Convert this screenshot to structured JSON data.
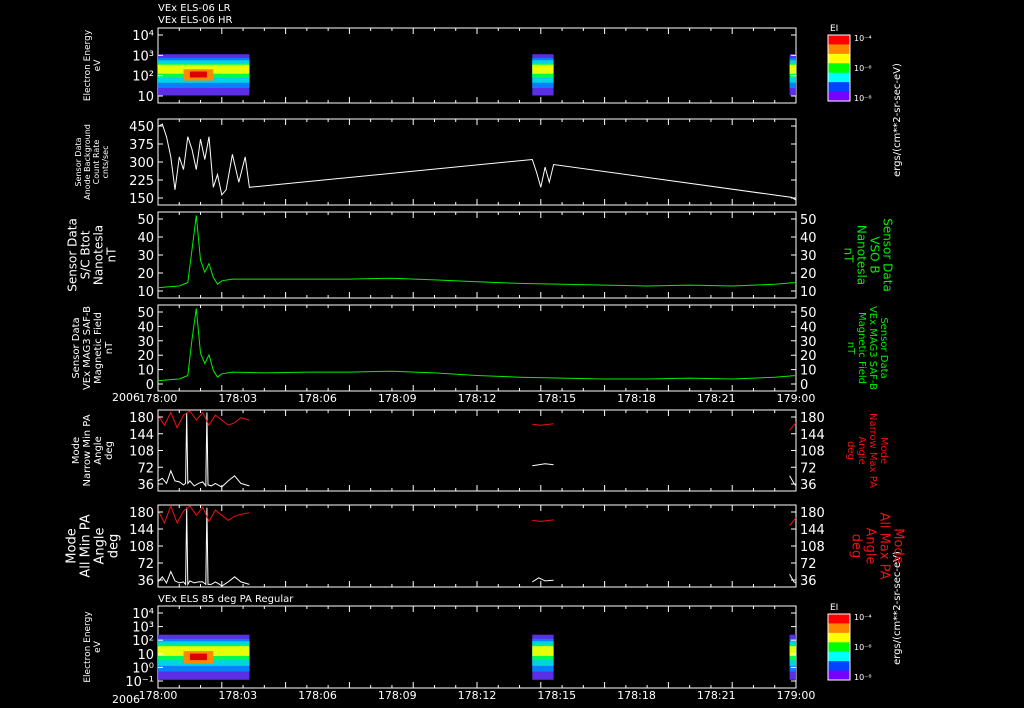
{
  "header": {
    "line1": "VEx ELS-06 LR",
    "line2": "VEx ELS-06 HR",
    "panel7_title": "VEx ELS 85 deg PA Regular"
  },
  "colorbar": {
    "label": "EI",
    "units": "ergs/(cm**2-sr-sec-eV)",
    "ticks": [
      "10⁻⁴",
      "10⁻⁶",
      "10⁻⁸"
    ]
  },
  "time_axis": {
    "year": "2006",
    "ticks": [
      "178:00",
      "178:03",
      "178:06",
      "178:09",
      "178:12",
      "178:15",
      "178:18",
      "178:21",
      "179:00"
    ]
  },
  "colors": {
    "green": "#00ee00",
    "red": "#ee1111",
    "white": "#ffffff"
  },
  "chart_data": [
    {
      "type": "heatmap",
      "panel": "electron-spectrogram-top",
      "ylabel": [
        "Electron Energy",
        "eV"
      ],
      "yticks": [
        "10⁴",
        "10³",
        "10²",
        "10"
      ],
      "ylog": true,
      "data_intervals_minutes": [
        [
          0.0,
          4.3
        ],
        [
          17.6,
          18.6
        ],
        [
          29.7,
          30.0
        ]
      ]
    },
    {
      "type": "line",
      "panel": "anode-count-rate",
      "ylabel": [
        "Sensor Data",
        "Anode Background",
        "Count Rate",
        "cnts/sec"
      ],
      "yticks": [
        "450",
        "375",
        "300",
        "225",
        "150"
      ],
      "ylim": [
        110,
        450
      ],
      "series": [
        {
          "color": "white",
          "x": [
            0.0,
            0.2,
            0.4,
            0.6,
            0.8,
            1.0,
            1.2,
            1.4,
            1.6,
            1.8,
            2.0,
            2.2,
            2.4,
            2.6,
            2.8,
            3.0,
            3.2,
            3.5,
            3.8,
            4.1,
            4.3,
            17.6,
            17.8,
            18.0,
            18.2,
            18.4,
            18.6,
            29.8,
            30.0
          ],
          "y": [
            420,
            430,
            380,
            300,
            170,
            300,
            250,
            380,
            330,
            250,
            370,
            290,
            380,
            180,
            230,
            150,
            170,
            310,
            200,
            300,
            180,
            290,
            240,
            180,
            260,
            200,
            270,
            140,
            130
          ]
        }
      ]
    },
    {
      "type": "line",
      "panel": "sc-bmag",
      "ylabel": [
        "Sensor Data",
        "S/C Btot",
        "Nanotesla",
        "nT"
      ],
      "ylabel_right": [
        "Sensor Data",
        "VSO B",
        "Nanotesla",
        "nT"
      ],
      "yticks": [
        "50",
        "40",
        "30",
        "20",
        "10"
      ],
      "ylim": [
        0,
        50
      ],
      "series": [
        {
          "color": "green",
          "x": [
            0,
            0.5,
            1.0,
            1.4,
            1.6,
            1.8,
            2.0,
            2.2,
            2.4,
            2.6,
            2.8,
            3.0,
            3.5,
            5,
            7,
            9,
            11,
            13,
            15,
            17,
            19,
            21,
            23,
            25,
            27,
            29,
            30
          ],
          "y": [
            6,
            6.5,
            7,
            9,
            28,
            48,
            22,
            15,
            20,
            12,
            8,
            10,
            11,
            11,
            11,
            11,
            11.5,
            10.5,
            9.5,
            8.5,
            8,
            7.5,
            7,
            7.5,
            7,
            8,
            9
          ]
        }
      ]
    },
    {
      "type": "line",
      "panel": "mag-field",
      "ylabel": [
        "Sensor Data",
        "VEx MAG3 SAF-B",
        "Magnetic Field",
        "nT"
      ],
      "ylabel_right": [
        "Sensor Data",
        "VEx MAG3 SAF-B",
        "Magnetic Field",
        "nT"
      ],
      "yticks": [
        "50",
        "40",
        "30",
        "20",
        "10",
        "0"
      ],
      "ylim": [
        0,
        50
      ],
      "series": [
        {
          "color": "green",
          "x": [
            0,
            0.5,
            1.0,
            1.4,
            1.6,
            1.8,
            2.0,
            2.2,
            2.4,
            2.6,
            2.8,
            3.0,
            3.5,
            5,
            7,
            9,
            11,
            13,
            15,
            17,
            19,
            21,
            23,
            25,
            27,
            29,
            30
          ],
          "y": [
            6,
            6.5,
            7,
            9,
            30,
            48,
            22,
            16,
            21,
            12,
            8,
            10,
            11,
            10.5,
            11,
            11,
            11.5,
            10.5,
            9,
            8,
            7.5,
            7,
            7,
            7.5,
            7,
            8,
            9
          ]
        }
      ]
    },
    {
      "type": "line",
      "panel": "narrow-pa",
      "ylabel": [
        "Mode",
        "Narrow Min PA",
        "Angle",
        "deg"
      ],
      "ylabel_right": [
        "Mode",
        "Narrow Max PA",
        "Angle",
        "deg"
      ],
      "yticks": [
        "180",
        "144",
        "108",
        "72",
        "36"
      ],
      "ylim": [
        20,
        180
      ],
      "series": [
        {
          "color": "white",
          "x": [
            0.0,
            0.2,
            0.4,
            0.6,
            0.8,
            1.0,
            1.2,
            1.3,
            1.35,
            1.4,
            1.5,
            1.7,
            1.9,
            2.1,
            2.25,
            2.3,
            2.35,
            2.5,
            2.7,
            2.9,
            3.0,
            3.3,
            3.6,
            3.9,
            4.3
          ],
          "y": [
            40,
            45,
            35,
            60,
            40,
            38,
            32,
            35,
            175,
            35,
            40,
            30,
            35,
            38,
            30,
            175,
            32,
            30,
            35,
            30,
            28,
            40,
            50,
            35,
            30
          ]
        },
        {
          "color": "white",
          "x": [
            17.6,
            17.9,
            18.2,
            18.6
          ],
          "y": [
            70,
            72,
            74,
            72
          ]
        },
        {
          "color": "white",
          "x": [
            29.7,
            29.9,
            30.0
          ],
          "y": [
            50,
            35,
            30
          ]
        },
        {
          "color": "red",
          "x": [
            0.0,
            0.3,
            0.6,
            0.9,
            1.2,
            1.5,
            1.8,
            2.1,
            2.4,
            2.7,
            3.0,
            3.3,
            3.6,
            3.9,
            4.3
          ],
          "y": [
            170,
            150,
            175,
            145,
            170,
            178,
            160,
            175,
            150,
            170,
            160,
            150,
            155,
            165,
            160
          ]
        },
        {
          "color": "red",
          "x": [
            17.6,
            18.0,
            18.6
          ],
          "y": [
            152,
            150,
            153
          ]
        },
        {
          "color": "red",
          "x": [
            29.7,
            30.0
          ],
          "y": [
            140,
            155
          ]
        }
      ]
    },
    {
      "type": "line",
      "panel": "all-pa",
      "ylabel": [
        "Mode",
        "All Min PA",
        "Angle",
        "deg"
      ],
      "ylabel_right": [
        "Mode",
        "All Max PA",
        "Angle",
        "deg"
      ],
      "yticks": [
        "180",
        "144",
        "108",
        "72",
        "36"
      ],
      "ylim": [
        20,
        180
      ],
      "series": [
        {
          "color": "white",
          "x": [
            0.0,
            0.2,
            0.4,
            0.6,
            0.8,
            1.0,
            1.2,
            1.3,
            1.35,
            1.4,
            1.5,
            1.7,
            1.9,
            2.1,
            2.25,
            2.3,
            2.35,
            2.5,
            2.7,
            2.9,
            3.0,
            3.3,
            3.6,
            3.9,
            4.3
          ],
          "y": [
            30,
            40,
            28,
            50,
            32,
            28,
            30,
            25,
            175,
            25,
            32,
            28,
            30,
            30,
            25,
            175,
            25,
            25,
            30,
            25,
            22,
            30,
            40,
            30,
            25
          ]
        },
        {
          "color": "white",
          "x": [
            17.6,
            17.9,
            18.2,
            18.6
          ],
          "y": [
            30,
            38,
            32,
            33
          ]
        },
        {
          "color": "white",
          "x": [
            29.7,
            29.9,
            30.0
          ],
          "y": [
            45,
            30,
            28
          ]
        },
        {
          "color": "red",
          "x": [
            0.0,
            0.3,
            0.6,
            0.9,
            1.2,
            1.5,
            1.8,
            2.1,
            2.4,
            2.7,
            3.0,
            3.3,
            3.6,
            3.9,
            4.3
          ],
          "y": [
            170,
            145,
            178,
            145,
            168,
            178,
            160,
            176,
            148,
            170,
            160,
            150,
            158,
            162,
            165
          ]
        },
        {
          "color": "red",
          "x": [
            17.6,
            18.0,
            18.6
          ],
          "y": [
            150,
            148,
            151
          ]
        },
        {
          "color": "red",
          "x": [
            29.7,
            30.0
          ],
          "y": [
            140,
            155
          ]
        }
      ]
    },
    {
      "type": "heatmap",
      "panel": "electron-spectrogram-85pa",
      "ylabel": [
        "Electron Energy",
        "eV"
      ],
      "yticks": [
        "10⁴",
        "10³",
        "10²",
        "10",
        "10⁰",
        "10⁻¹"
      ],
      "ylog": true,
      "data_intervals_minutes": [
        [
          0.0,
          4.3
        ],
        [
          17.6,
          18.6
        ],
        [
          29.7,
          30.0
        ]
      ]
    }
  ]
}
